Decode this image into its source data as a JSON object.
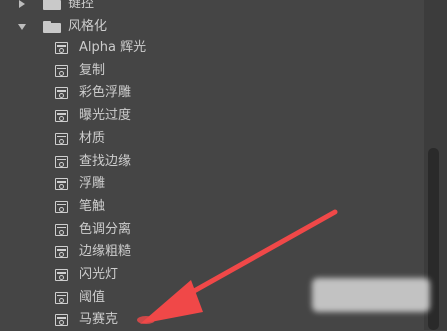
{
  "tree": {
    "top_item": "键控",
    "group": {
      "label": "风格化",
      "children": [
        "Alpha 辉光",
        "复制",
        "彩色浮雕",
        "曝光过度",
        "材质",
        "查找边缘",
        "浮雕",
        "笔触",
        "色调分离",
        "边缘粗糙",
        "闪光灯",
        "阈值",
        "马赛克"
      ]
    }
  },
  "colors": {
    "background": "#454545",
    "text": "#cdcdcd",
    "annotation_arrow": "#f04848"
  }
}
